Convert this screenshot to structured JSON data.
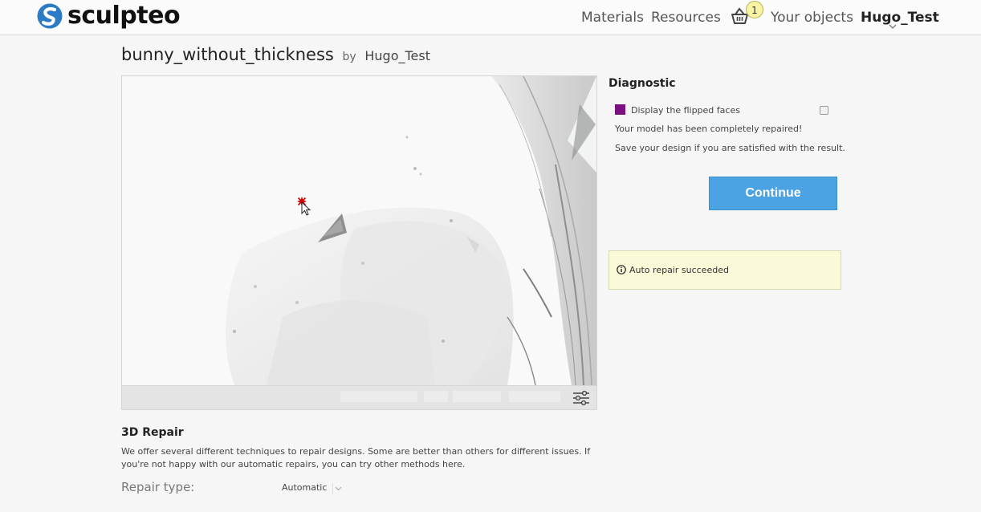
{
  "header": {
    "brand": "sculpteo",
    "nav": {
      "materials": "Materials",
      "resources": "Resources",
      "your_objects": "Your objects",
      "user": "Hugo_Test"
    },
    "cart_count": "1",
    "icons": [
      "sculpteo-logo-icon",
      "basket-icon",
      "chevron-down-icon"
    ]
  },
  "design": {
    "name": "bunny_without_thickness",
    "by": "by",
    "author": "Hugo_Test"
  },
  "viewer": {
    "icons": [
      "settings-sliders-icon",
      "cursor-icon"
    ]
  },
  "diagnostic": {
    "title": "Diagnostic",
    "flipped_label": "Display the flipped faces",
    "flipped_color": "#7b1080",
    "message1": "Your model has been completely repaired!",
    "message2": "Save your design if you are satisfied with the result.",
    "continue_label": "Continue",
    "alert_text": "Auto repair succeeded",
    "accent_color": "#4ba3e3"
  },
  "repair": {
    "title": "3D Repair",
    "description": "We offer several different techniques to repair designs. Some are better than others for different issues. If you're not happy with our automatic repairs, you can try other methods here.",
    "type_label": "Repair type:",
    "type_value": "Automatic"
  }
}
